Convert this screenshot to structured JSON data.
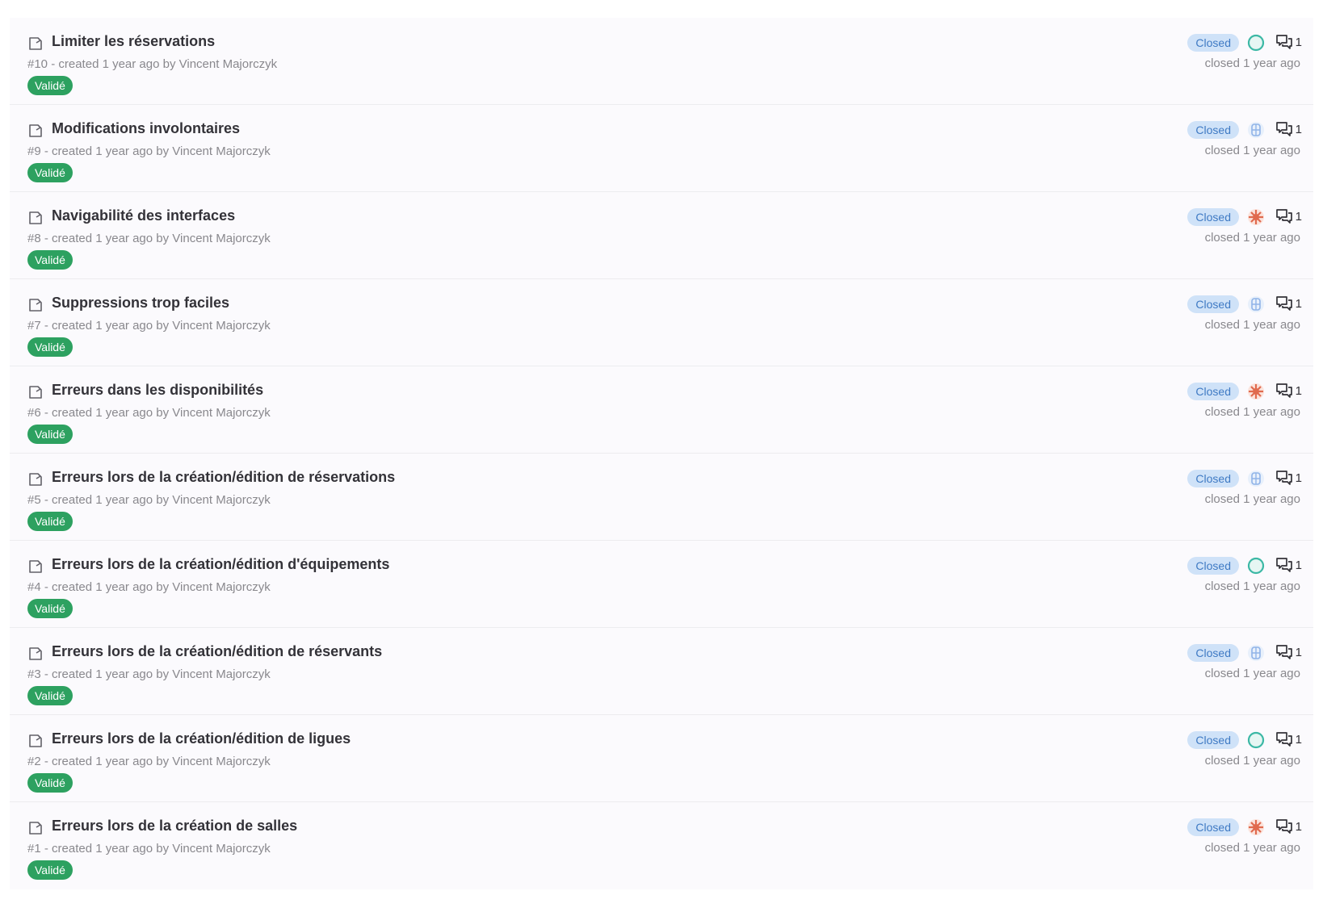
{
  "issues": [
    {
      "title": "Limiter les réservations",
      "number": "#10",
      "created": "created 1 year ago by",
      "author": "Vincent Majorczyk",
      "label": "Validé",
      "status": "Closed",
      "comments": "1",
      "closed": "closed 1 year ago",
      "avatar_style": "teal-ring",
      "label_color": "#2da160"
    },
    {
      "title": "Modifications involontaires",
      "number": "#9",
      "created": "created 1 year ago by",
      "author": "Vincent Majorczyk",
      "label": "Validé",
      "status": "Closed",
      "comments": "1",
      "closed": "closed 1 year ago",
      "avatar_style": "blue-pattern",
      "label_color": "#2da160"
    },
    {
      "title": "Navigabilité des interfaces",
      "number": "#8",
      "created": "created 1 year ago by",
      "author": "Vincent Majorczyk",
      "label": "Validé",
      "status": "Closed",
      "comments": "1",
      "closed": "closed 1 year ago",
      "avatar_style": "red-pattern",
      "label_color": "#2da160"
    },
    {
      "title": "Suppressions trop faciles",
      "number": "#7",
      "created": "created 1 year ago by",
      "author": "Vincent Majorczyk",
      "label": "Validé",
      "status": "Closed",
      "comments": "1",
      "closed": "closed 1 year ago",
      "avatar_style": "blue-pattern",
      "label_color": "#2da160"
    },
    {
      "title": "Erreurs dans les disponibilités",
      "number": "#6",
      "created": "created 1 year ago by",
      "author": "Vincent Majorczyk",
      "label": "Validé",
      "status": "Closed",
      "comments": "1",
      "closed": "closed 1 year ago",
      "avatar_style": "red-pattern",
      "label_color": "#2da160"
    },
    {
      "title": "Erreurs lors de la création/édition de réservations",
      "number": "#5",
      "created": "created 1 year ago by",
      "author": "Vincent Majorczyk",
      "label": "Validé",
      "status": "Closed",
      "comments": "1",
      "closed": "closed 1 year ago",
      "avatar_style": "blue-pattern",
      "label_color": "#2da160"
    },
    {
      "title": "Erreurs lors de la création/édition d'équipements",
      "number": "#4",
      "created": "created 1 year ago by",
      "author": "Vincent Majorczyk",
      "label": "Validé",
      "status": "Closed",
      "comments": "1",
      "closed": "closed 1 year ago",
      "avatar_style": "teal-ring",
      "label_color": "#2da160"
    },
    {
      "title": "Erreurs lors de la création/édition de réservants",
      "number": "#3",
      "created": "created 1 year ago by",
      "author": "Vincent Majorczyk",
      "label": "Validé",
      "status": "Closed",
      "comments": "1",
      "closed": "closed 1 year ago",
      "avatar_style": "blue-pattern",
      "label_color": "#2da160"
    },
    {
      "title": "Erreurs lors de la création/édition de ligues",
      "number": "#2",
      "created": "created 1 year ago by",
      "author": "Vincent Majorczyk",
      "label": "Validé",
      "status": "Closed",
      "comments": "1",
      "closed": "closed 1 year ago",
      "avatar_style": "teal-ring",
      "label_color": "#2da160"
    },
    {
      "title": "Erreurs lors de la création de salles",
      "number": "#1",
      "created": "created 1 year ago by",
      "author": "Vincent Majorczyk",
      "label": "Validé",
      "status": "Closed",
      "comments": "1",
      "closed": "closed 1 year ago",
      "avatar_style": "red-pattern",
      "label_color": "#2da160"
    }
  ],
  "icons": {
    "issue": "issue-closed-icon",
    "comments": "comments-icon",
    "avatar": "assignee-avatar"
  },
  "colors": {
    "label_green": "#2da160",
    "status_bg": "#cfe2f8",
    "status_text": "#3f7ac4",
    "avatar_teal": "#3cb8a5",
    "avatar_blue": "#8fb3e8",
    "avatar_red": "#e06a4e"
  }
}
